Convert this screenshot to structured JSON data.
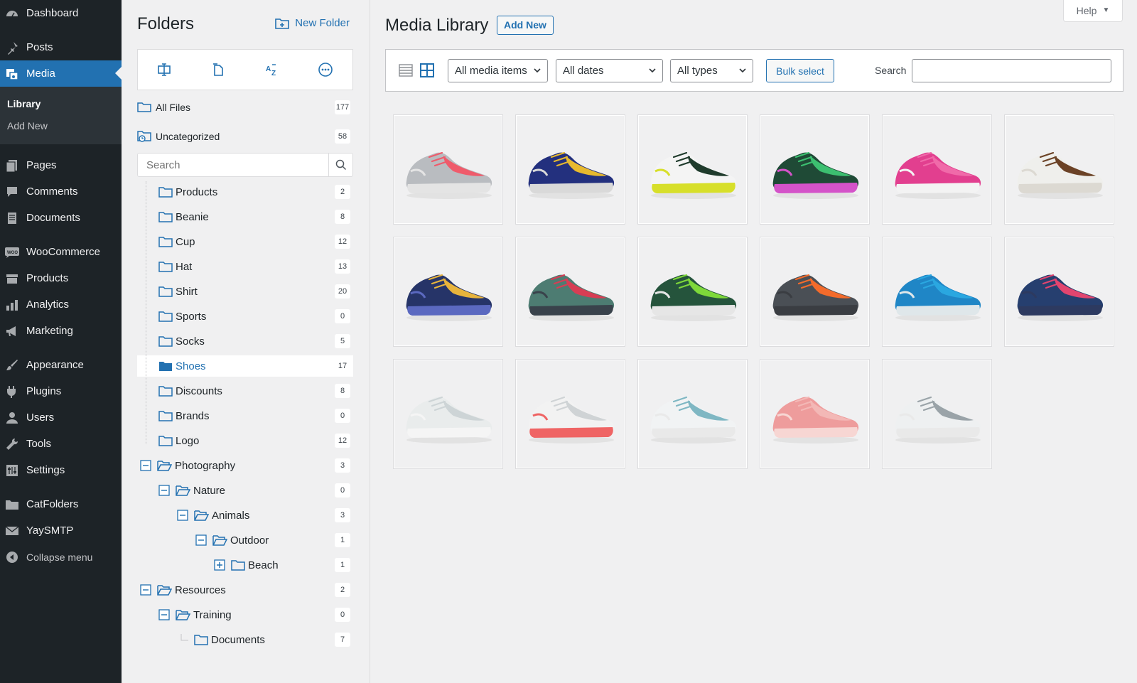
{
  "admin_menu": {
    "items": [
      {
        "label": "Dashboard",
        "icon": "dashboard-icon"
      },
      {
        "label": "Posts",
        "icon": "pushpin-icon"
      },
      {
        "label": "Media",
        "icon": "media-icon",
        "active": true
      },
      {
        "label": "Pages",
        "icon": "pages-icon"
      },
      {
        "label": "Comments",
        "icon": "comments-icon"
      },
      {
        "label": "Documents",
        "icon": "documents-icon"
      },
      {
        "label": "WooCommerce",
        "icon": "woo-icon"
      },
      {
        "label": "Products",
        "icon": "products-icon"
      },
      {
        "label": "Analytics",
        "icon": "analytics-icon"
      },
      {
        "label": "Marketing",
        "icon": "megaphone-icon"
      },
      {
        "label": "Appearance",
        "icon": "brush-icon"
      },
      {
        "label": "Plugins",
        "icon": "plugins-icon"
      },
      {
        "label": "Users",
        "icon": "users-icon"
      },
      {
        "label": "Tools",
        "icon": "wrench-icon"
      },
      {
        "label": "Settings",
        "icon": "settings-icon"
      },
      {
        "label": "CatFolders",
        "icon": "folder-icon"
      },
      {
        "label": "YaySMTP",
        "icon": "envelope-icon"
      }
    ],
    "submenu": [
      "Library",
      "Add New"
    ],
    "collapse_label": "Collapse menu"
  },
  "folders": {
    "title": "Folders",
    "new_folder_label": "New Folder",
    "all_files": {
      "label": "All Files",
      "count": "177"
    },
    "uncategorized": {
      "label": "Uncategorized",
      "count": "58"
    },
    "search_placeholder": "Search",
    "tree": [
      {
        "label": "Products",
        "count": "2"
      },
      {
        "label": "Beanie",
        "count": "8"
      },
      {
        "label": "Cup",
        "count": "12"
      },
      {
        "label": "Hat",
        "count": "13"
      },
      {
        "label": "Shirt",
        "count": "20"
      },
      {
        "label": "Sports",
        "count": "0"
      },
      {
        "label": "Socks",
        "count": "5"
      },
      {
        "label": "Shoes",
        "count": "17",
        "selected": true
      },
      {
        "label": "Discounts",
        "count": "8"
      },
      {
        "label": "Brands",
        "count": "0"
      },
      {
        "label": "Logo",
        "count": "12"
      },
      {
        "label": "Photography",
        "count": "3",
        "toggle": "minus"
      },
      {
        "label": "Nature",
        "count": "0",
        "toggle": "minus"
      },
      {
        "label": "Animals",
        "count": "3",
        "toggle": "minus"
      },
      {
        "label": "Outdoor",
        "count": "1",
        "toggle": "minus"
      },
      {
        "label": "Beach",
        "count": "1",
        "toggle": "plus"
      },
      {
        "label": "Resources",
        "count": "2",
        "toggle": "minus"
      },
      {
        "label": "Training",
        "count": "0",
        "toggle": "minus"
      },
      {
        "label": "Documents",
        "count": "7"
      }
    ]
  },
  "main": {
    "title": "Media Library",
    "add_new": "Add New",
    "help": "Help",
    "filters": {
      "media_type": "All media items",
      "dates": "All dates",
      "types": "All types",
      "bulk_select": "Bulk select",
      "search_label": "Search"
    },
    "items": [
      {
        "base": "#b9bcc0",
        "accent": "#ef5b6b",
        "sole": "#e4e4e4"
      },
      {
        "base": "#23307e",
        "accent": "#e7b92e",
        "sole": "#d9d9d9"
      },
      {
        "base": "#f4f4f4",
        "accent": "#1f3b2c",
        "sole": "#d7df2a"
      },
      {
        "base": "#1f4a36",
        "accent": "#3cbf70",
        "sole": "#d453c9"
      },
      {
        "base": "#e23f8f",
        "accent": "#f06aa9",
        "sole": "#f3f3f3"
      },
      {
        "base": "#efefec",
        "accent": "#6b4226",
        "sole": "#dcd9d2"
      },
      {
        "base": "#263468",
        "accent": "#e8b43c",
        "sole": "#5b69c0"
      },
      {
        "base": "#4d7c72",
        "accent": "#d73d54",
        "sole": "#39424b"
      },
      {
        "base": "#25543c",
        "accent": "#7ed83a",
        "sole": "#e6e6e6"
      },
      {
        "base": "#4a4f55",
        "accent": "#f36b2b",
        "sole": "#3a3d42"
      },
      {
        "base": "#1f86c6",
        "accent": "#2aa7e0",
        "sole": "#dfe7ea"
      },
      {
        "base": "#263f6f",
        "accent": "#e2456f",
        "sole": "#2d3a60"
      },
      {
        "base": "#e9ecec",
        "accent": "#cdd4d6",
        "sole": "#f5f5f5"
      },
      {
        "base": "#f2f2f2",
        "accent": "#cfd3d5",
        "sole": "#ef6464"
      },
      {
        "base": "#f1f3f4",
        "accent": "#7fb7c3",
        "sole": "#e9e9e9"
      },
      {
        "base": "#ee9c9c",
        "accent": "#f3b8b6",
        "sole": "#f7d6d3"
      },
      {
        "base": "#eef0f1",
        "accent": "#9aa3a8",
        "sole": "#e9e9e9"
      }
    ]
  },
  "colors": {
    "accent": "#2271b1",
    "sidebar": "#1d2327"
  }
}
